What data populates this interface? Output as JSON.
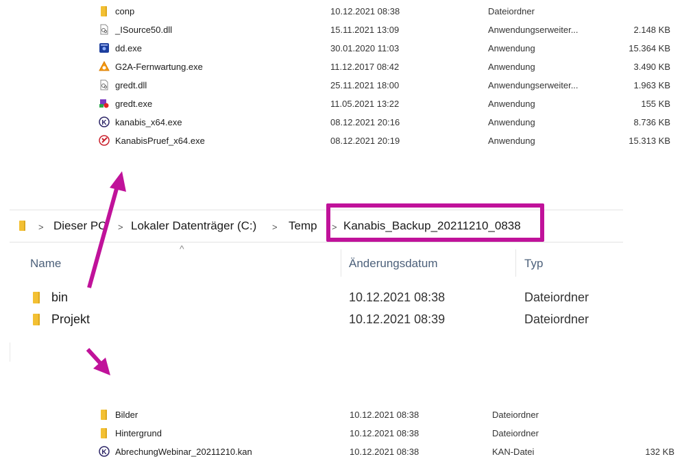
{
  "top_list": {
    "rows": [
      {
        "name": "conp",
        "date": "10.12.2021 08:38",
        "type": "Dateiordner",
        "size": "",
        "icon": "folder-icon"
      },
      {
        "name": "_ISource50.dll",
        "date": "15.11.2021 13:09",
        "type": "Anwendungserweiter...",
        "size": "2.148 KB",
        "icon": "dll-file-icon"
      },
      {
        "name": "dd.exe",
        "date": "30.01.2020 11:03",
        "type": "Anwendung",
        "size": "15.364 KB",
        "icon": "dd-app-icon"
      },
      {
        "name": "G2A-Fernwartung.exe",
        "date": "11.12.2017 08:42",
        "type": "Anwendung",
        "size": "3.490 KB",
        "icon": "g2a-app-icon"
      },
      {
        "name": "gredt.dll",
        "date": "25.11.2021 18:00",
        "type": "Anwendungserweiter...",
        "size": "1.963 KB",
        "icon": "dll-file-icon"
      },
      {
        "name": "gredt.exe",
        "date": "11.05.2021 13:22",
        "type": "Anwendung",
        "size": "155 KB",
        "icon": "gredt-app-icon"
      },
      {
        "name": "kanabis_x64.exe",
        "date": "08.12.2021 20:16",
        "type": "Anwendung",
        "size": "8.736 KB",
        "icon": "kanabis-app-icon"
      },
      {
        "name": "KanabisPruef_x64.exe",
        "date": "08.12.2021 20:19",
        "type": "Anwendung",
        "size": "15.313 KB",
        "icon": "kanabis-pruef-icon"
      }
    ]
  },
  "explorer": {
    "breadcrumb": [
      "Dieser PC",
      "Lokaler Datenträger (C:)",
      "Temp",
      "Kanabis_Backup_20211210_0838"
    ],
    "columns": {
      "name": "Name",
      "date": "Änderungsdatum",
      "type": "Typ"
    },
    "rows": [
      {
        "name": "bin",
        "date": "10.12.2021 08:38",
        "type": "Dateiordner"
      },
      {
        "name": "Projekt",
        "date": "10.12.2021 08:39",
        "type": "Dateiordner"
      }
    ]
  },
  "bottom_list": {
    "rows": [
      {
        "name": "Bilder",
        "date": "10.12.2021 08:38",
        "type": "Dateiordner",
        "size": "",
        "icon": "folder-icon"
      },
      {
        "name": "Hintergrund",
        "date": "10.12.2021 08:38",
        "type": "Dateiordner",
        "size": "",
        "icon": "folder-icon"
      },
      {
        "name": "AbrechungWebinar_20211210.kan",
        "date": "10.12.2021 08:38",
        "type": "KAN-Datei",
        "size": "132 KB",
        "icon": "kanabis-app-icon"
      }
    ]
  },
  "colors": {
    "highlight": "#c0129a",
    "arrow": "#c0129a",
    "folder": "#f3c033"
  }
}
